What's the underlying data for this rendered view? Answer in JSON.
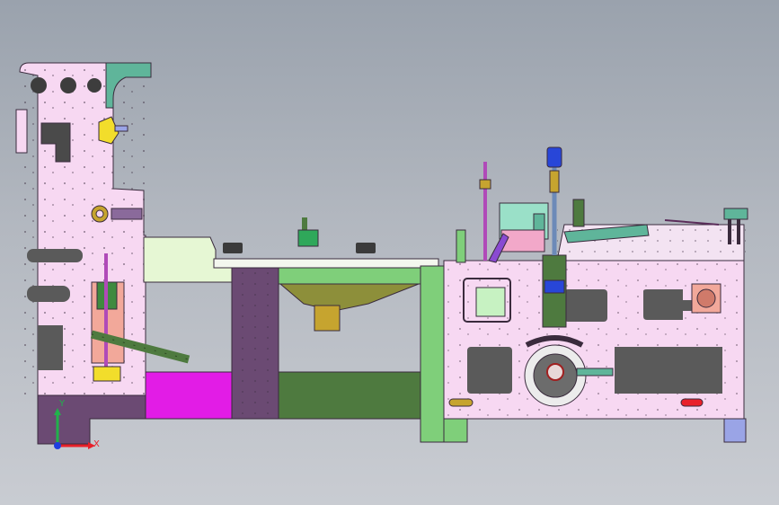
{
  "viewport": {
    "background_top": "#9aa2ad",
    "background_bottom": "#c9ccd2"
  },
  "triad": {
    "x_label": "X",
    "y_label": "Y",
    "x_color": "#e8202a",
    "y_color": "#22b14c",
    "z_color": "#1f3ee0"
  },
  "colors": {
    "frame_pink": "#f7d8f2",
    "light_green_plate": "#e6f7d4",
    "dark_purple": "#6b4a73",
    "olive_green": "#4e7a3f",
    "bright_green": "#7fcf7a",
    "magenta": "#e21ce6",
    "salmon": "#f2a89a",
    "teal": "#5fb59a",
    "gold": "#c6a42f",
    "lavender": "#9aa4e6",
    "blue": "#2846d8",
    "outline": "#3a2b3d"
  }
}
